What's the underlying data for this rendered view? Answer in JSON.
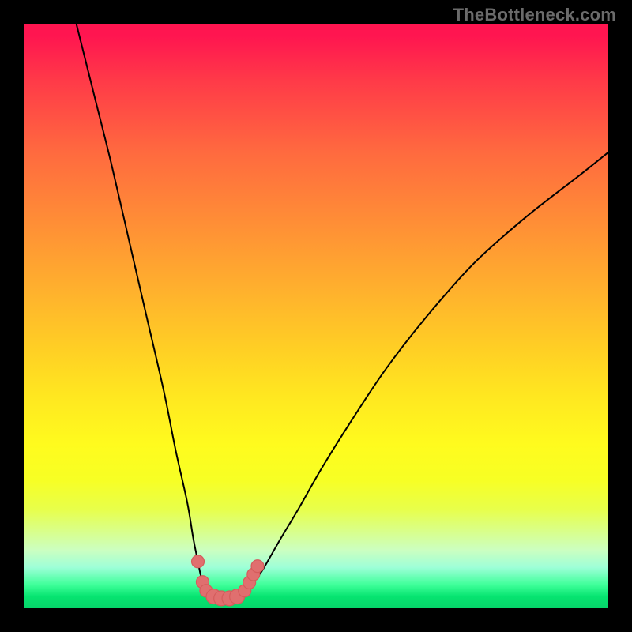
{
  "watermark": "TheBottleneck.com",
  "colors": {
    "background": "#000000",
    "gradient_top": "#ff1550",
    "gradient_mid": "#fffb1e",
    "gradient_bottom": "#06d46a",
    "curve": "#000000",
    "marker": "#e06f6f"
  },
  "chart_data": {
    "type": "line",
    "title": "",
    "xlabel": "",
    "ylabel": "",
    "xlim": [
      0,
      100
    ],
    "ylim": [
      0,
      100
    ],
    "grid": false,
    "legend": false,
    "annotations": [
      "TheBottleneck.com"
    ],
    "series": [
      {
        "name": "left-branch",
        "x": [
          9,
          12,
          15,
          18,
          21,
          24,
          26,
          28,
          29,
          29.8,
          30.2,
          30.6,
          31,
          31.5,
          32
        ],
        "y": [
          100,
          88,
          76,
          63,
          50,
          37,
          27,
          18,
          12,
          8,
          6,
          4.5,
          3.5,
          2.8,
          2.2
        ]
      },
      {
        "name": "right-branch",
        "x": [
          37,
          38,
          39,
          40.5,
          42,
          44,
          47,
          51,
          56,
          62,
          69,
          77,
          86,
          95,
          100
        ],
        "y": [
          2.2,
          3,
          4.2,
          6,
          8.5,
          12,
          17,
          24,
          32,
          41,
          50,
          59,
          67,
          74,
          78
        ]
      },
      {
        "name": "valley-floor",
        "x": [
          32,
          33,
          34,
          35,
          36,
          37
        ],
        "y": [
          2.2,
          1.8,
          1.6,
          1.6,
          1.8,
          2.2
        ]
      }
    ],
    "markers": [
      {
        "x": 29.8,
        "y": 8,
        "r": 1.1
      },
      {
        "x": 30.6,
        "y": 4.5,
        "r": 1.1
      },
      {
        "x": 31.2,
        "y": 3.0,
        "r": 1.1
      },
      {
        "x": 32.5,
        "y": 2.0,
        "r": 1.3
      },
      {
        "x": 33.8,
        "y": 1.7,
        "r": 1.3
      },
      {
        "x": 35.2,
        "y": 1.7,
        "r": 1.3
      },
      {
        "x": 36.5,
        "y": 2.0,
        "r": 1.3
      },
      {
        "x": 37.8,
        "y": 3.0,
        "r": 1.1
      },
      {
        "x": 38.6,
        "y": 4.4,
        "r": 1.1
      },
      {
        "x": 39.3,
        "y": 5.8,
        "r": 1.1
      },
      {
        "x": 40.0,
        "y": 7.2,
        "r": 1.1
      }
    ]
  }
}
